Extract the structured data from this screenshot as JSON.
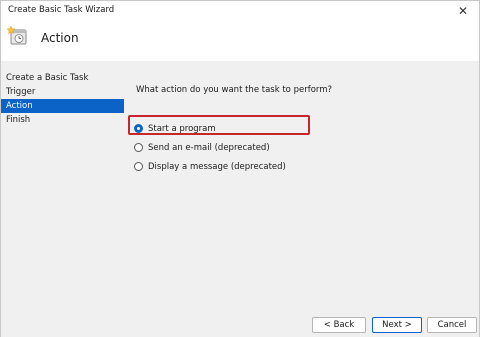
{
  "window": {
    "title": "Create Basic Task Wizard",
    "close_glyph": "✕"
  },
  "header": {
    "icon": "task-scheduler-clock-icon",
    "title": "Action"
  },
  "sidebar": {
    "items": [
      {
        "label": "Create a Basic Task",
        "active": false
      },
      {
        "label": "Trigger",
        "active": false
      },
      {
        "label": "Action",
        "active": true
      },
      {
        "label": "Finish",
        "active": false
      }
    ]
  },
  "main": {
    "question": "What action do you want the task to perform?",
    "options": [
      {
        "label": "Start a program",
        "selected": true,
        "highlighted": true
      },
      {
        "label": "Send an e-mail (deprecated)",
        "selected": false
      },
      {
        "label": "Display a message (deprecated)",
        "selected": false
      }
    ]
  },
  "buttons": {
    "back": "< Back",
    "next": "Next >",
    "cancel": "Cancel"
  },
  "colors": {
    "accent": "#0b63c7",
    "highlight": "#c8252c",
    "panel_bg": "#f0f0f0"
  }
}
